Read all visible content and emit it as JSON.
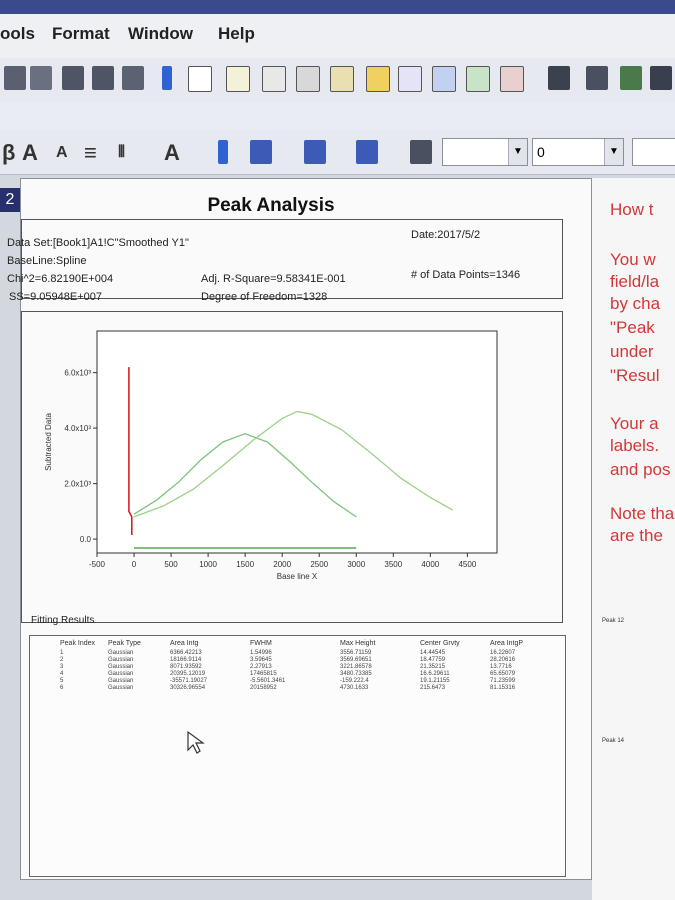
{
  "menu": {
    "items": [
      "ools",
      "Format",
      "Window",
      "Help"
    ]
  },
  "toolbar2": {
    "line_combo": "",
    "num_combo": "0"
  },
  "doc_tab": {
    "label": "2"
  },
  "sheet": {
    "title": "Peak Analysis",
    "dataset": "Data Set:[Book1]A1!C\"Smoothed Y1\"",
    "baseline": "BaseLine:Spline",
    "chi2": "Chi^2=6.82190E+004",
    "ss": "SS=9.05948E+007",
    "adj_r": "Adj. R-Square=9.58341E-001",
    "dof": "Degree of Freedom=1328",
    "date": "Date:2017/5/2",
    "points": "# of Data Points=1346",
    "fitting_label": "Fitting Results"
  },
  "chart_data": {
    "type": "line",
    "xlabel": "Base line X",
    "ylabel": "Subtracted Data",
    "xlim": [
      -500,
      4900
    ],
    "ylim": [
      -500,
      7500
    ],
    "x_ticks": [
      "-500",
      "0",
      "500",
      "1000",
      "1500",
      "2000",
      "2500",
      "3000",
      "3500",
      "4000",
      "4500"
    ],
    "y_ticks": [
      "0.0",
      "2.0x10³",
      "4.0x10³",
      "6.0x10³"
    ],
    "y_tick_values": [
      0,
      2000,
      4000,
      6000
    ],
    "series": [
      {
        "color": "#7bc47b",
        "x": [
          0,
          300,
          600,
          900,
          1200,
          1500,
          1800,
          2100,
          2400,
          2700,
          3000
        ],
        "y": [
          900,
          1400,
          2050,
          2850,
          3500,
          3800,
          3500,
          2800,
          2050,
          1350,
          800
        ]
      },
      {
        "color": "#9ccf86",
        "x": [
          0,
          400,
          800,
          1200,
          1600,
          2000,
          2200,
          2400,
          2800,
          3200,
          3600,
          4000,
          4300
        ],
        "y": [
          800,
          1200,
          1800,
          2650,
          3550,
          4350,
          4600,
          4500,
          3950,
          3100,
          2200,
          1500,
          1050
        ]
      },
      {
        "color": "#d62222",
        "x": [
          -70,
          -70,
          -30,
          -30
        ],
        "y": [
          6200,
          1000,
          800,
          150
        ]
      },
      {
        "color": "#2e9e2e",
        "x": [
          0,
          3000
        ],
        "y": [
          -320,
          -320
        ]
      }
    ]
  },
  "table": {
    "headers": [
      "Peak Index",
      "Peak Type",
      "Area Intg",
      "FWHM",
      "Max Height",
      "Center Grvty",
      "Area IntgP"
    ],
    "rows": [
      [
        "1",
        "Gaussian",
        "6366.42213",
        "1.54996",
        "3556.71159",
        "14.44545",
        "16.22607"
      ],
      [
        "2",
        "Gaussian",
        "18166.9114",
        "3.59645",
        "3569.69651",
        "18.47759",
        "28.20616"
      ],
      [
        "3",
        "Gaussian",
        "8071.93592",
        "2.27913",
        "3221.86578",
        "21.35215",
        "13.7716"
      ],
      [
        "4",
        "Gaussian",
        "20395.12019",
        "17465815",
        "3480.73385",
        "16.6.29611",
        "65.65079"
      ],
      [
        "5",
        "Gaussian",
        "-35571.19027",
        "-5.5601.3461",
        "-159.222.4",
        "19.1.21155",
        "71.23599"
      ],
      [
        "6",
        "Gaussian",
        "30326.96554",
        "20158952",
        "4730.1633",
        "215.6473",
        "81.15316"
      ]
    ]
  },
  "right_text": {
    "lines": [
      "How t",
      "You w",
      "field/la",
      "by cha",
      "\"Peak",
      "under",
      "\"Resul",
      "Your a",
      "labels.",
      "and pos",
      "Note tha",
      "are the"
    ],
    "small1": "Peak 12",
    "small2": "Peak 14"
  }
}
